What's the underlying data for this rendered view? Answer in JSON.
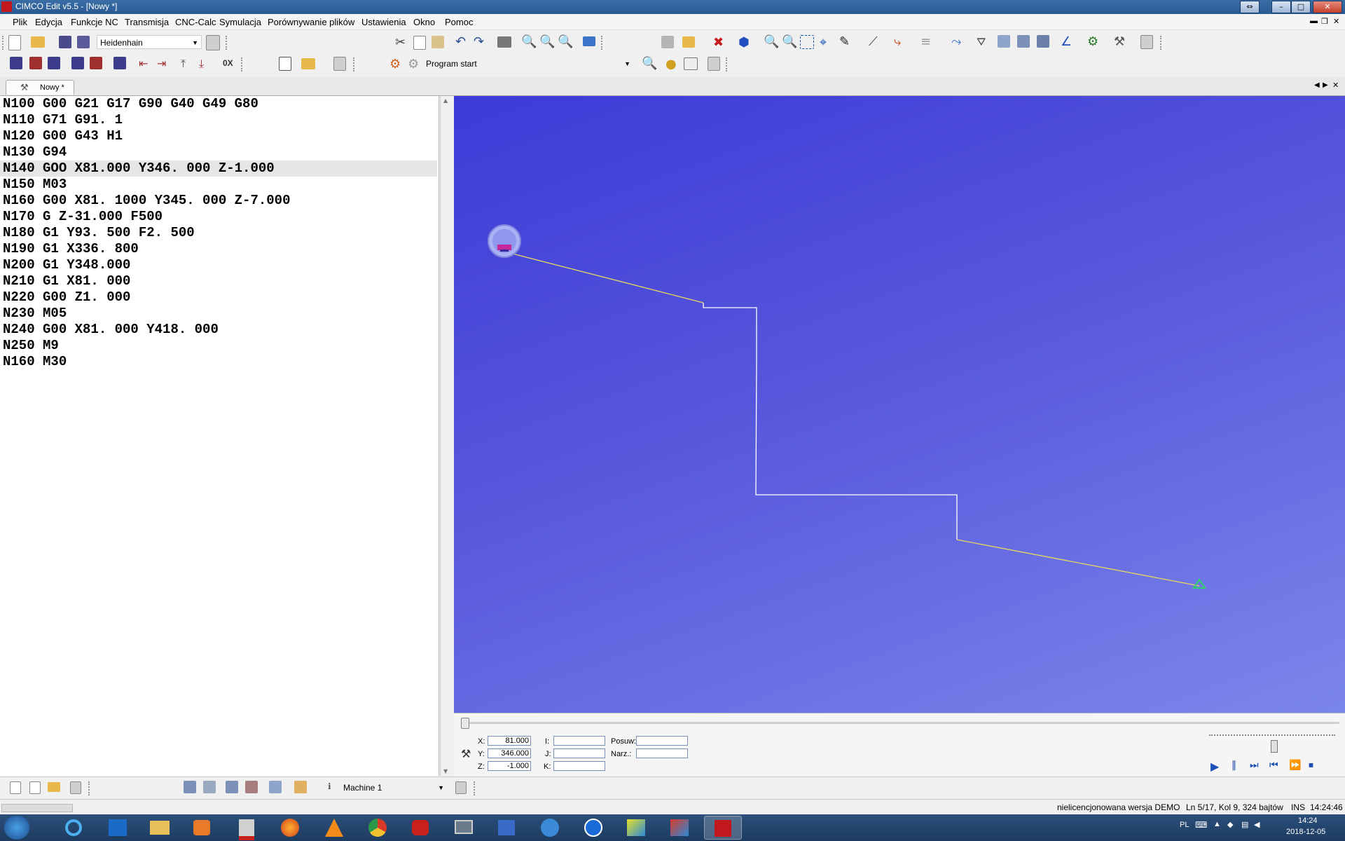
{
  "window": {
    "title": "CIMCO Edit v5.5 - [Nowy *]"
  },
  "menu": [
    "Plik",
    "Edycja",
    "Funkcje NC",
    "Transmisja",
    "CNC-Calc",
    "Symulacja",
    "Porównywanie plików",
    "Ustawienia",
    "Okno",
    "Pomoc"
  ],
  "toolbar": {
    "machine_type": "Heidenhain",
    "program_start": "Program start"
  },
  "tab": {
    "label": "Nowy *"
  },
  "code_lines": [
    "N100 G00 G21 G17 G90 G40 G49 G80",
    "N110 G71 G91. 1",
    "N120 G00 G43 H1",
    "N130 G94",
    "N140 GOO X81.000 Y346. 000 Z-1.000",
    "N150 M03",
    "N160 G00 X81. 1000 Y345. 000 Z-7.000",
    "N170 G Z-31.000 F500",
    "N180 G1 Y93. 500 F2. 500",
    "N190 G1 X336. 800",
    "N200 G1 Y348.000",
    "N210 G1 X81. 000",
    "N220 G00 Z1. 000",
    "N230 M05",
    "N240 G00 X81. 000 Y418. 000",
    "N250 M9",
    "N160 M30"
  ],
  "current_line_index": 4,
  "simulation": {
    "x_label": "X:",
    "x_value": "81.000",
    "y_label": "Y:",
    "y_value": "346.000",
    "z_label": "Z:",
    "z_value": "-1.000",
    "i_label": "I:",
    "j_label": "J:",
    "k_label": "K:",
    "feed_label": "Posuw:",
    "tool_label": "Narz.:"
  },
  "bottom_toolbar": {
    "machine": "Machine 1"
  },
  "status": {
    "license": "nielicencjonowana wersja DEMO",
    "position": "Ln 5/17, Kol 9, 324 bajtów",
    "mode": "INS",
    "time": "14:24:46"
  },
  "taskbar": {
    "language": "PL",
    "clock_time": "14:24",
    "clock_date": "2018-12-05"
  },
  "colors": {
    "toolpath_rapid": "#e8d860",
    "toolpath_feed": "#ffffff",
    "tool": "#a9b2f5",
    "end_marker": "#2fd06b"
  }
}
